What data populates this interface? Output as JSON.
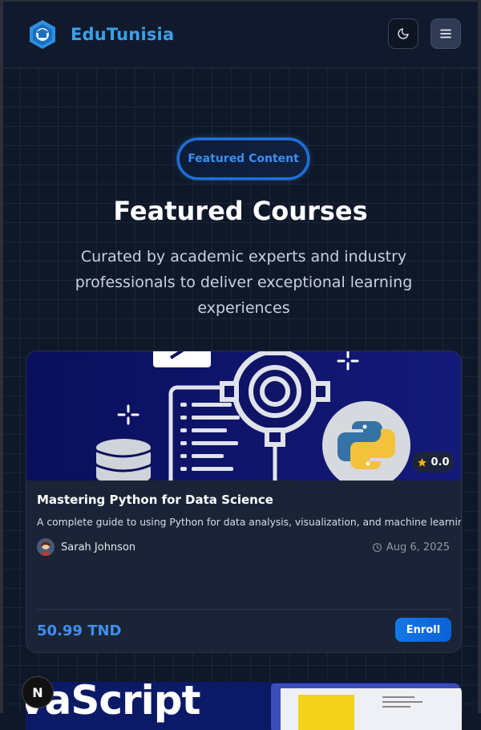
{
  "header": {
    "brand": "EduTunisia",
    "logo_icon": "graduation-cap-logo-icon",
    "theme_toggle_icon": "moon-icon",
    "menu_icon": "hamburger-menu-icon"
  },
  "hero": {
    "badge": "Featured Content",
    "title": "Featured Courses",
    "subtitle": "Curated by academic experts and industry professionals to deliver exceptional learning experiences"
  },
  "courses": [
    {
      "title": "Mastering Python for Data Science",
      "description": "A complete guide to using Python for data analysis, visualization, and machine learning.",
      "rating": "0.0",
      "author": "Sarah Johnson",
      "date": "Aug 6, 2025",
      "price": "50.99 TND",
      "enroll_label": "Enroll"
    },
    {
      "thumbnail_text": "vaScript"
    }
  ],
  "dev_badge": "N",
  "colors": {
    "accent": "#3d8ff0",
    "brand": "#3aa0e8",
    "background": "#0f1829",
    "card": "#1a2436"
  }
}
